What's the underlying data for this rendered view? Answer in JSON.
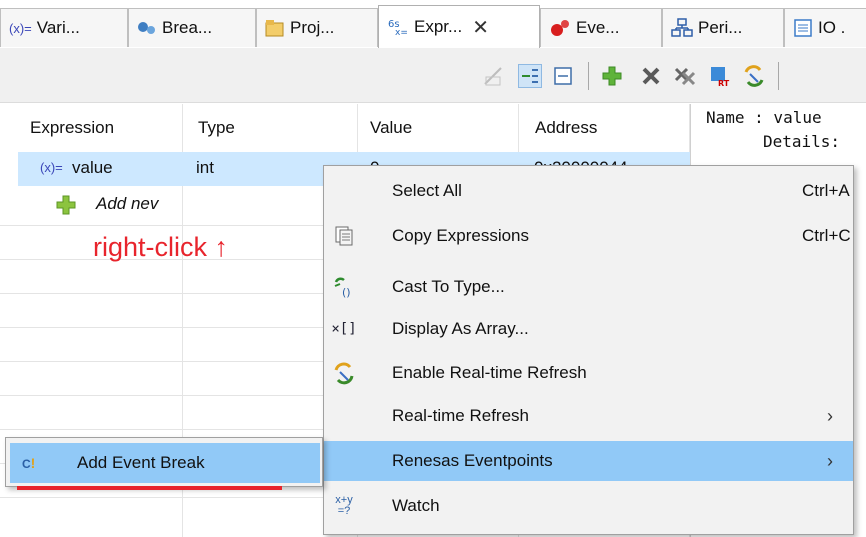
{
  "tabs": [
    {
      "icon": "variables-icon",
      "icon_text": "(x)=",
      "label": "Vari..."
    },
    {
      "icon": "breakpoints-icon",
      "label": "Brea..."
    },
    {
      "icon": "project-icon",
      "label": "Proj..."
    },
    {
      "icon": "expressions-icon",
      "label": "Expr...",
      "active": true,
      "close": "✕"
    },
    {
      "icon": "events-icon",
      "label": "Eve..."
    },
    {
      "icon": "peripherals-icon",
      "label": "Peri..."
    },
    {
      "icon": "io-registers-icon",
      "label": "IO ."
    }
  ],
  "table": {
    "headers": [
      "Expression",
      "Type",
      "Value",
      "Address"
    ],
    "rows": [
      {
        "expression": "value",
        "expr_icon_text": "(x)=",
        "type": "int",
        "value": "0",
        "address": "0x20000044"
      },
      {
        "expression": "Add nev",
        "type": "",
        "value": "",
        "address": ""
      }
    ]
  },
  "details": {
    "line1": "Name : value",
    "line2": "Details:"
  },
  "annotation": "right-click ↑",
  "context_menu": {
    "items": [
      {
        "label": "Select All",
        "shortcut": "Ctrl+A",
        "icon": ""
      },
      {
        "label": "Copy Expressions",
        "shortcut": "Ctrl+C",
        "icon": "copy-icon"
      },
      {
        "label": "Cast To Type...",
        "shortcut": "",
        "icon": "cast-icon"
      },
      {
        "label": "Display As Array...",
        "shortcut": "",
        "icon": "array-icon",
        "icon_text": "×[]"
      },
      {
        "label": "Enable Real-time Refresh",
        "shortcut": "",
        "icon": "realtime-refresh-icon"
      },
      {
        "label": "Real-time Refresh",
        "shortcut": "",
        "icon": "",
        "submenu": true
      },
      {
        "label": "Renesas Eventpoints",
        "shortcut": "",
        "icon": "",
        "submenu": true,
        "highlighted": true
      },
      {
        "label": "Watch",
        "shortcut": "",
        "icon": "watch-icon",
        "icon_text": "x+y"
      }
    ],
    "arrow": "›"
  },
  "submenu": {
    "item_label": "Add Event Break",
    "icon": "event-break-icon",
    "icon_text": "C!"
  },
  "colors": {
    "highlight": "#91c9f7",
    "selection": "#cde8ff",
    "annotation": "#e8242c"
  }
}
